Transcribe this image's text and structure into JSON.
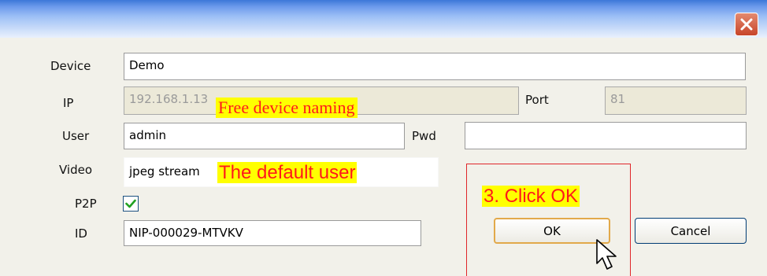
{
  "form": {
    "device_label": "Device",
    "device_value": "Demo",
    "ip_label": "IP",
    "ip_value": "192.168.1.13",
    "port_label": "Port",
    "port_value": "81",
    "user_label": "User",
    "user_value": "admin",
    "pwd_label": "Pwd",
    "pwd_value": "",
    "video_label": "Video",
    "video_value": "jpeg stream",
    "p2p_label": "P2P",
    "p2p_checked": true,
    "id_label": "ID",
    "id_value": "NIP-000029-MTVKV"
  },
  "buttons": {
    "ok": "OK",
    "cancel": "Cancel"
  },
  "annotations": {
    "naming": "Free device naming",
    "default_user": "The default user",
    "click_ok": "3. Click OK"
  },
  "icons": {
    "close": "close-icon",
    "check": "check-icon",
    "cursor": "mouse-cursor-icon"
  },
  "colors": {
    "annotation_text": "#ff1a1a",
    "annotation_bg": "#ffff00",
    "close_button": "#d15b3d"
  }
}
